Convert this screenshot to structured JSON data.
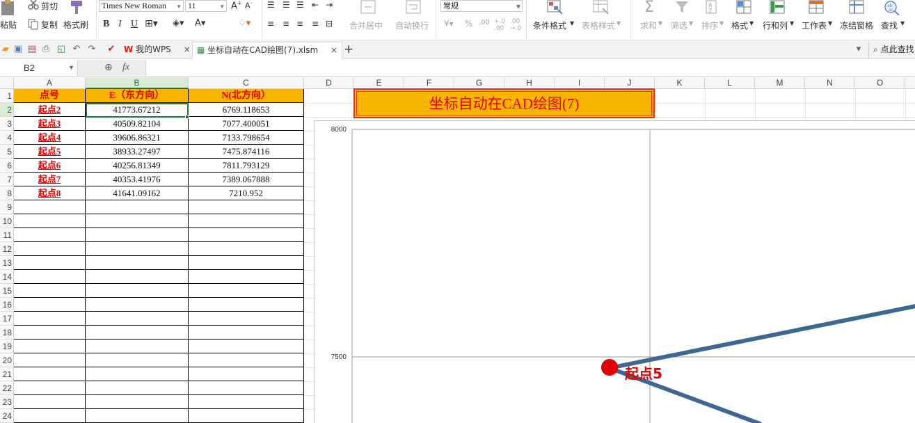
{
  "ribbon": {
    "paste": "粘贴",
    "cut": "剪切",
    "copy": "复制",
    "format_painter": "格式刷",
    "font_name": "Times New Roman",
    "font_size": "11",
    "number_format": "常规",
    "merge_center": "合并居中",
    "wrap_text": "自动换行",
    "conditional_format": "条件格式",
    "table_style": "表格样式",
    "sum": "求和",
    "filter": "筛选",
    "sort": "排序",
    "format": "格式",
    "row_col": "行和列",
    "worksheet": "工作表",
    "freeze_panes": "冻结窗格",
    "find": "查找",
    "bold": "B",
    "italic": "I",
    "underline": "U",
    "percent": "%"
  },
  "tabs": {
    "wps_home": "我的WPS",
    "file_tab": "坐标自动在CAD绘图(7).xlsm",
    "new_tab": "+",
    "search_hint": "点此查找"
  },
  "formula_bar": {
    "cell_ref": "B2",
    "fx": "fx",
    "content": ""
  },
  "columns": [
    "A",
    "B",
    "C",
    "D",
    "E",
    "F",
    "G",
    "H",
    "I",
    "J",
    "K",
    "L",
    "M",
    "N",
    "O"
  ],
  "rows": [
    "1",
    "2",
    "3",
    "4",
    "5",
    "6",
    "7",
    "8",
    "9",
    "10",
    "11",
    "12",
    "13",
    "14",
    "15",
    "16",
    "17",
    "18",
    "19",
    "20",
    "21",
    "22",
    "23",
    "24"
  ],
  "sheet": {
    "headers": [
      "点号",
      "E（东方向）",
      "N(北方向）"
    ],
    "data": [
      [
        "起点2",
        "41773.67212",
        "6769.118653"
      ],
      [
        "起点3",
        "40509.82104",
        "7077.400051"
      ],
      [
        "起点4",
        "39606.86321",
        "7133.798654"
      ],
      [
        "起点5",
        "38933.27497",
        "7475.874116"
      ],
      [
        "起点6",
        "40256.81349",
        "7811.793129"
      ],
      [
        "起点7",
        "40353.41976",
        "7389.067888"
      ],
      [
        "起点8",
        "41641.09162",
        "7210.952"
      ]
    ]
  },
  "banner": "坐标自动在CAD绘图(7)",
  "chart_data": {
    "type": "scatter",
    "y_ticks": [
      "8000",
      "7500"
    ],
    "highlight_label": "起点5",
    "colors": {
      "line": "#3f6793",
      "marker": "#e00000",
      "label": "#e00000"
    }
  }
}
